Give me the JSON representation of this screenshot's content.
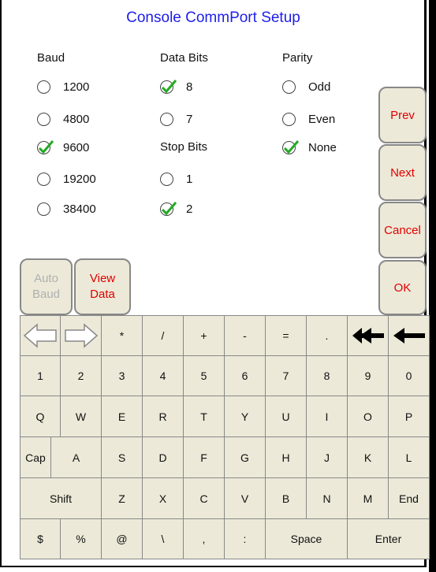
{
  "window": {
    "title": "Console CommPort Setup"
  },
  "baud": {
    "label": "Baud",
    "options": [
      {
        "label": "1200",
        "checked": false
      },
      {
        "label": "4800",
        "checked": false
      },
      {
        "label": "9600",
        "checked": true
      },
      {
        "label": "19200",
        "checked": false
      },
      {
        "label": "38400",
        "checked": false
      }
    ]
  },
  "data_bits": {
    "label": "Data Bits",
    "options": [
      {
        "label": "8",
        "checked": true
      },
      {
        "label": "7",
        "checked": false
      }
    ]
  },
  "stop_bits": {
    "label": "Stop Bits",
    "options": [
      {
        "label": "1",
        "checked": false
      },
      {
        "label": "2",
        "checked": true
      }
    ]
  },
  "parity": {
    "label": "Parity",
    "options": [
      {
        "label": "Odd",
        "checked": false
      },
      {
        "label": "Even",
        "checked": false
      },
      {
        "label": "None",
        "checked": true
      }
    ]
  },
  "side_buttons": {
    "prev": "Prev",
    "next": "Next",
    "cancel": "Cancel",
    "ok": "OK"
  },
  "auto_baud": {
    "line1": "Auto",
    "line2": "Baud"
  },
  "view_data": {
    "line1": "View",
    "line2": "Data"
  },
  "keyboard": {
    "row0": [
      "*",
      "/",
      "+",
      "-",
      "=",
      "."
    ],
    "row1": [
      "1",
      "2",
      "3",
      "4",
      "5",
      "6",
      "7",
      "8",
      "9",
      "0"
    ],
    "row2": [
      "Q",
      "W",
      "E",
      "R",
      "T",
      "Y",
      "U",
      "I",
      "O",
      "P"
    ],
    "row3": [
      "Cap",
      "A",
      "S",
      "D",
      "F",
      "G",
      "H",
      "J",
      "K",
      "L"
    ],
    "row4": [
      "Shift",
      "Z",
      "X",
      "C",
      "V",
      "B",
      "N",
      "M",
      "End"
    ],
    "row5": [
      "$",
      "%",
      "@",
      "\\",
      ",",
      ":",
      "Space",
      "Enter"
    ]
  },
  "colors": {
    "accent": "#1e1ee8",
    "button_text": "#e00000",
    "disabled_text": "#b0b0b0",
    "check": "#22aa22",
    "key_bg": "#ece9d8"
  },
  "icons": {
    "left_arrow": "left-arrow-outline-icon",
    "right_arrow": "right-arrow-outline-icon",
    "clear_all": "double-left-arrow-icon",
    "backspace": "left-arrow-icon"
  }
}
